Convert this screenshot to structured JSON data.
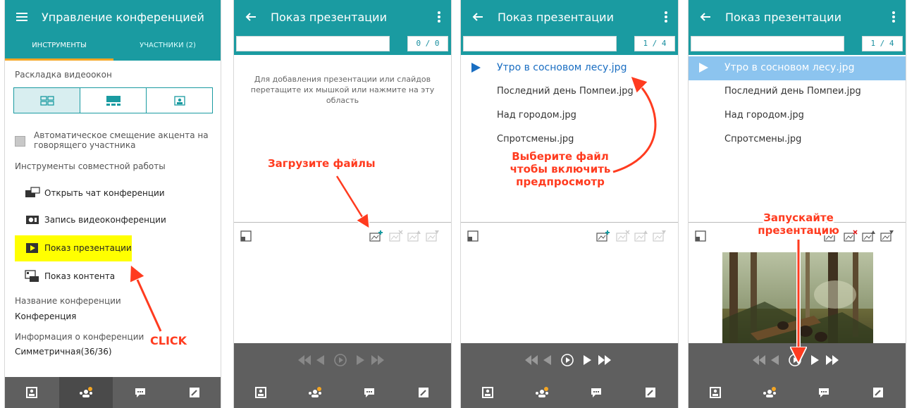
{
  "panel1": {
    "title": "Управление конференцией",
    "tabs": [
      "ИНСТРУМЕНТЫ",
      "УЧАСТНИКИ (2)"
    ],
    "layout_label": "Раскладка видеоокон",
    "auto_accent": "Автоматическое смещение акцента на говорящего участника",
    "collab_label": "Инструменты совместной работы",
    "tools": [
      "Открыть чат конференции",
      "Запись видеоконференции",
      "Показ презентации",
      "Показ контента"
    ],
    "conf_name_label": "Название конференции",
    "conf_name": "Конференция",
    "conf_info_label": "Информация о конференции",
    "conf_info": "Симметричная(36/36)",
    "annotation": "CLICK"
  },
  "panel2": {
    "title": "Показ презентации",
    "counter": "0 / 0",
    "hint": "Для добавления презентации или слайдов перетащите их мышкой или нажмите на эту область",
    "annotation": "Загрузите файлы"
  },
  "panel3": {
    "title": "Показ презентации",
    "counter": "1 / 4",
    "files": [
      "Утро в сосновом лесу.jpg",
      "Последний день Помпеи.jpg",
      "Над городом.jpg",
      "Спротсмены.jpg"
    ],
    "annotation": "Выберите файл чтобы включить предпросмотр"
  },
  "panel4": {
    "title": "Показ презентации",
    "counter": "1 / 4",
    "files": [
      "Утро в сосновом лесу.jpg",
      "Последний день Помпеи.jpg",
      "Над городом.jpg",
      "Спротсмены.jpg"
    ],
    "annotation": "Запускайте презентацию"
  },
  "colors": {
    "teal": "#1a9ba1",
    "annotation_red": "#ff3b1f",
    "highlight_yellow": "#ffff00",
    "selected_blue": "#1a6ec2",
    "row_highlight": "#8cc4ef",
    "nav_gray": "#5f5f5f"
  },
  "icons": {
    "menu": "hamburger-icon",
    "back": "back-arrow-icon",
    "overflow": "more-vert-icon",
    "nav": [
      "conference-list-icon",
      "participants-icon",
      "chat-icon",
      "edit-icon"
    ]
  }
}
